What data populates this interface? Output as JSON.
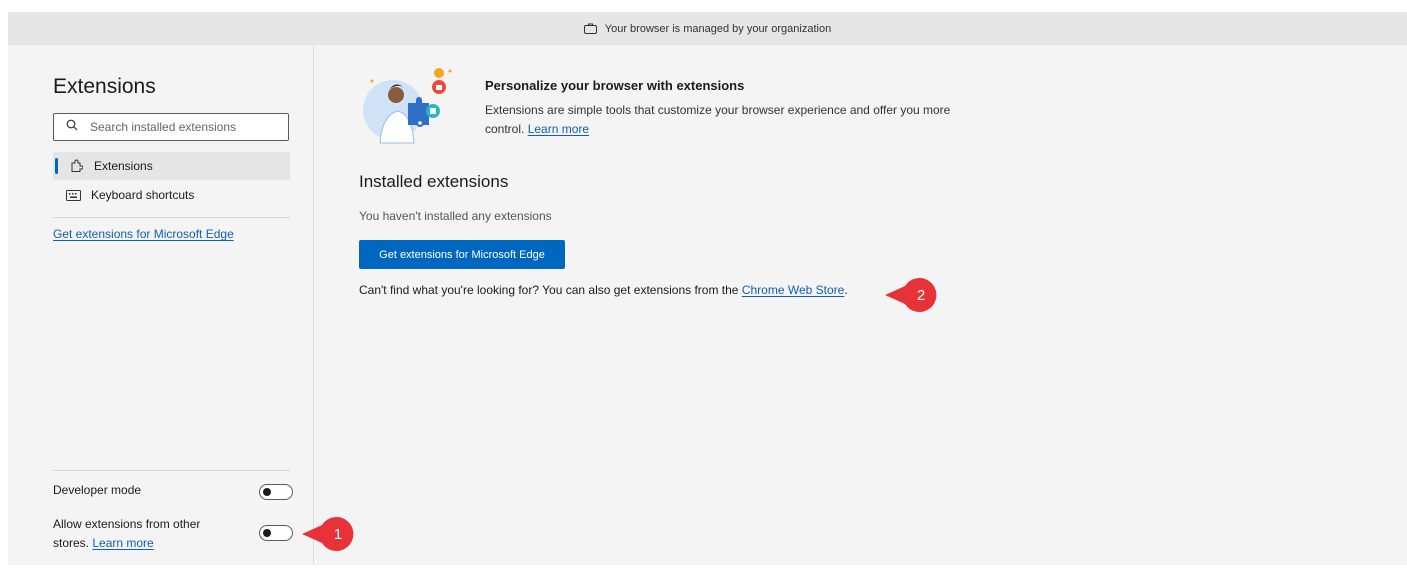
{
  "managed_bar": {
    "icon": "briefcase-icon",
    "text": "Your browser is managed by your organization"
  },
  "sidebar": {
    "title": "Extensions",
    "search": {
      "placeholder": "Search installed extensions",
      "value": "",
      "icon": "search-icon"
    },
    "nav_items": [
      {
        "label": "Extensions",
        "icon": "extensions-icon",
        "active": true
      },
      {
        "label": "Keyboard shortcuts",
        "icon": "keyboard-icon",
        "active": false
      }
    ],
    "get_extensions_link": "Get extensions for Microsoft Edge",
    "developer_mode": {
      "label": "Developer mode",
      "on": false
    },
    "allow_other_stores": {
      "label_prefix": "Allow extensions from other stores.",
      "link": "Learn more",
      "on": false
    }
  },
  "main": {
    "hero": {
      "title": "Personalize your browser with extensions",
      "description": "Extensions are simple tools that customize your browser experience and offer you more control.",
      "link": "Learn more"
    },
    "installed": {
      "title": "Installed extensions",
      "empty_text": "You haven't installed any extensions",
      "button_label": "Get extensions for Microsoft Edge",
      "store_prefix": "Can't find what you're looking for? You can also get extensions from the",
      "store_link": "Chrome Web Store",
      "store_suffix": "."
    }
  },
  "callouts": [
    {
      "number": "1"
    },
    {
      "number": "2"
    }
  ],
  "colors": {
    "accent": "#0067c0",
    "link": "#0f5fb5",
    "callout": "#e8323a"
  }
}
